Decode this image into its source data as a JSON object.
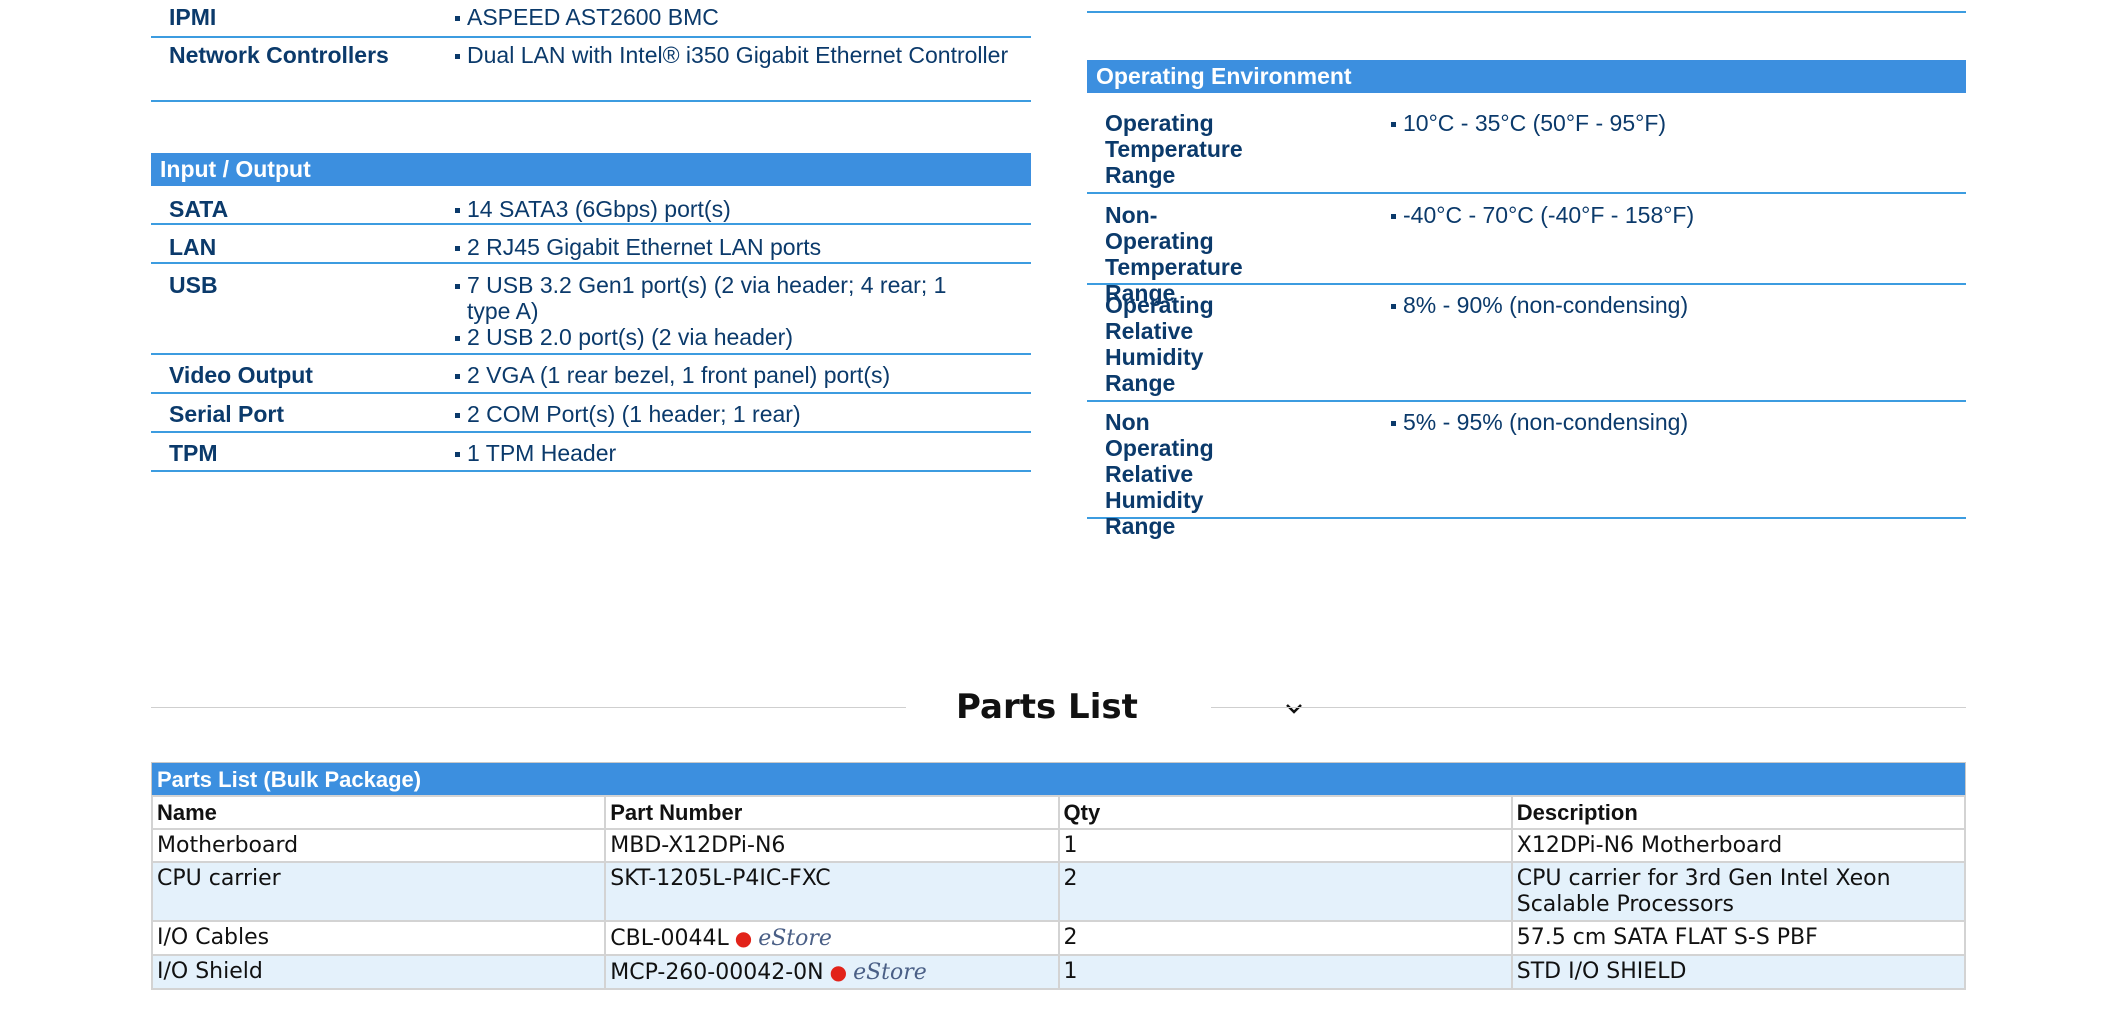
{
  "left_top_rows": [
    {
      "label": "IPMI",
      "values": [
        "ASPEED AST2600 BMC"
      ]
    },
    {
      "label": "Network Controllers",
      "values": [
        "Dual LAN with Intel® i350 Gigabit Ethernet Controller"
      ]
    }
  ],
  "io": {
    "heading": "Input / Output",
    "rows": [
      {
        "label": "SATA",
        "values": [
          "14 SATA3 (6Gbps) port(s)"
        ]
      },
      {
        "label": "LAN",
        "values": [
          "2 RJ45 Gigabit Ethernet LAN ports"
        ]
      },
      {
        "label": "USB",
        "values": [
          "7 USB 3.2 Gen1 port(s) (2 via header; 4 rear; 1 type A)",
          "2 USB 2.0 port(s) (2 via header)"
        ]
      },
      {
        "label": "Video Output",
        "values": [
          "2 VGA (1 rear bezel, 1 front panel) port(s)"
        ]
      },
      {
        "label": "Serial Port",
        "values": [
          "2 COM Port(s) (1 header; 1 rear)"
        ]
      },
      {
        "label": "TPM",
        "values": [
          "1 TPM Header"
        ]
      }
    ]
  },
  "env": {
    "heading": "Operating Environment",
    "rows": [
      {
        "label": "Operating Temperature Range",
        "values": [
          "10°C - 35°C (50°F - 95°F)"
        ]
      },
      {
        "label": "Non-Operating Temperature Range",
        "values": [
          "-40°C - 70°C (-40°F - 158°F)"
        ]
      },
      {
        "label": "Operating Relative Humidity Range",
        "values": [
          "8% - 90% (non-condensing)"
        ]
      },
      {
        "label": "Non Operating Relative Humidity Range",
        "values": [
          "5% - 95% (non-condensing)"
        ]
      }
    ]
  },
  "parts": {
    "section_title": "Parts List",
    "chevron_icon": "chevron-down-icon",
    "table_caption": "Parts List (Bulk Package)",
    "columns": [
      "Name",
      "Part Number",
      "Qty",
      "Description"
    ],
    "estore_label": "eStore",
    "rows": [
      {
        "name": "Motherboard",
        "part_number": "MBD-X12DPi-N6",
        "qty": "1",
        "description": "X12DPi-N6 Motherboard",
        "estore": false
      },
      {
        "name": "CPU carrier",
        "part_number": "SKT-1205L-P4IC-FXC",
        "qty": "2",
        "description": "CPU carrier for 3rd Gen Intel Xeon Scalable Processors",
        "estore": false
      },
      {
        "name": "I/O Cables",
        "part_number": "CBL-0044L",
        "qty": "2",
        "description": "57.5 cm SATA FLAT S-S PBF",
        "estore": true
      },
      {
        "name": "I/O Shield",
        "part_number": "MCP-260-00042-0N",
        "qty": "1",
        "description": "STD I/O SHIELD",
        "estore": true
      }
    ]
  },
  "colors": {
    "header_blue": "#3c8fdf",
    "rule_blue": "#3c9ce0",
    "text_navy": "#0b3a6b",
    "row_alt": "#e4f1fb",
    "estore_dot": "#e2231a"
  }
}
